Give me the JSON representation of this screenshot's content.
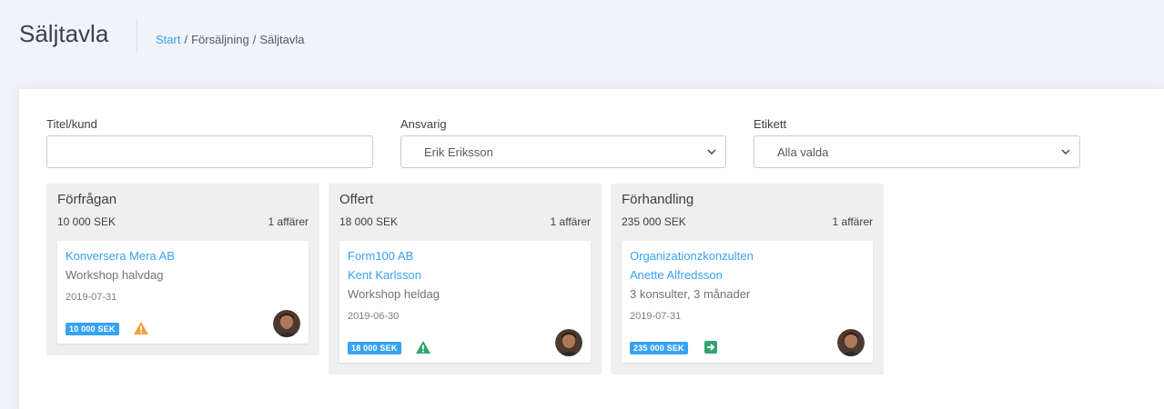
{
  "header": {
    "title": "Säljtavla",
    "breadcrumb": {
      "home": "Start",
      "separator": "/",
      "section": "Försäljning",
      "current": "Säljtavla"
    }
  },
  "filters": {
    "title_label": "Titel/kund",
    "title_value": "",
    "owner_label": "Ansvarig",
    "owner_value": "Erik Eriksson",
    "tag_label": "Etikett",
    "tag_value": "Alla valda"
  },
  "columns": [
    {
      "title": "Förfrågan",
      "sum": "10 000 SEK",
      "count": "1 affärer",
      "card": {
        "company": "Konversera Mera AB",
        "contact": "",
        "description": "Workshop halvdag",
        "date": "2019-07-31",
        "amount": "10 000 SEK",
        "status_icon": "warning-icon",
        "status_color": "#f4a03a"
      }
    },
    {
      "title": "Offert",
      "sum": "18 000 SEK",
      "count": "1 affärer",
      "card": {
        "company": "Form100 AB",
        "contact": "Kent Karlsson",
        "description": "Workshop heldag",
        "date": "2019-06-30",
        "amount": "18 000 SEK",
        "status_icon": "warning-icon",
        "status_color": "#34a36f"
      }
    },
    {
      "title": "Förhandling",
      "sum": "235 000 SEK",
      "count": "1 affärer",
      "card": {
        "company": "Organizationzkonzulten",
        "contact": "Anette Alfredsson",
        "description": "3 konsulter, 3 månader",
        "date": "2019-07-31",
        "amount": "235 000 SEK",
        "status_icon": "arrow-right-icon",
        "status_color": "#34a36f"
      }
    }
  ],
  "colors": {
    "accent": "#36a3f7",
    "background": "#f2f3f8",
    "column_bg": "#efefef"
  }
}
